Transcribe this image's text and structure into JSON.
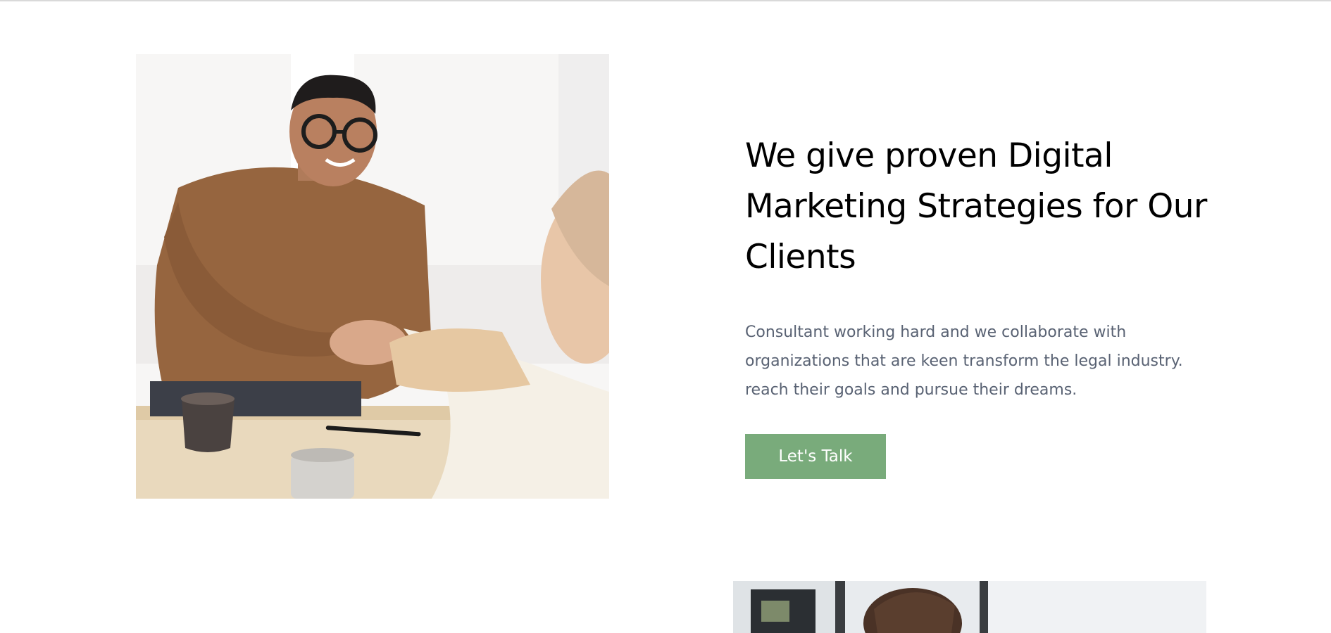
{
  "hero": {
    "headline": "We give proven Digital Marketing Strategies for Our Clients",
    "body": "Consultant working hard and we collaborate with organizations that are keen transform the legal industry. reach their goals and pursue their dreams.",
    "cta_label": "Let's Talk"
  },
  "colors": {
    "accent": "#79ab7b",
    "headline": "#000000",
    "body": "#596273"
  },
  "images": {
    "primary": "handshake-photo",
    "secondary": "office-photo"
  }
}
